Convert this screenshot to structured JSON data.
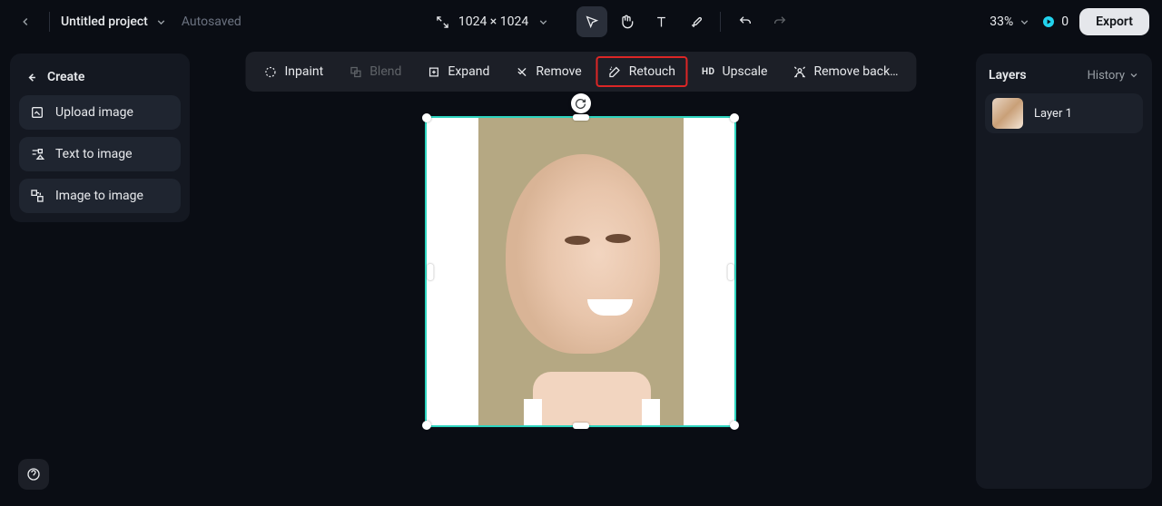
{
  "topbar": {
    "project_title": "Untitled project",
    "autosaved_label": "Autosaved",
    "canvas_size": "1024 × 1024",
    "zoom": "33%",
    "credits": "0",
    "export_label": "Export"
  },
  "actions": {
    "inpaint": "Inpaint",
    "blend": "Blend",
    "expand": "Expand",
    "remove": "Remove",
    "retouch": "Retouch",
    "upscale": "Upscale",
    "remove_bg": "Remove back…"
  },
  "sidebar": {
    "create_label": "Create",
    "upload_label": "Upload image",
    "text_to_image_label": "Text to image",
    "image_to_image_label": "Image to image"
  },
  "panel": {
    "layers_title": "Layers",
    "history_label": "History",
    "layer1_name": "Layer 1"
  },
  "highlighted_action": "retouch"
}
